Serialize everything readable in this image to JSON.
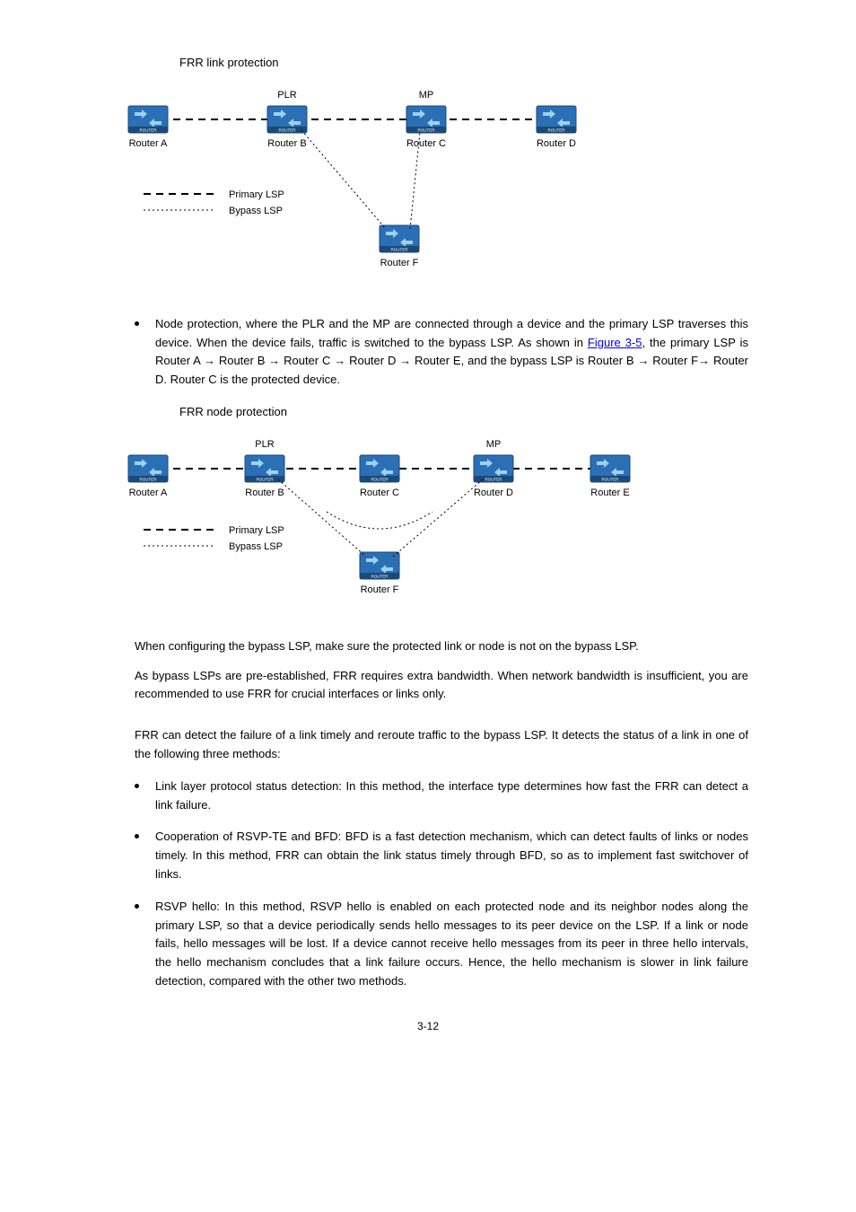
{
  "figure1": {
    "caption": "FRR link protection",
    "roles": {
      "plr": "PLR",
      "mp": "MP"
    },
    "routers": {
      "a": "Router A",
      "b": "Router B",
      "c": "Router C",
      "d": "Router D",
      "f": "Router F"
    },
    "legend": {
      "primary": "Primary LSP",
      "bypass": "Bypass LSP"
    }
  },
  "bullet_node_protection": {
    "pre": "Node protection, where the PLR and the MP are connected through a device and the primary LSP traverses this device. When the device fails, traffic is switched to the bypass LSP. As shown in ",
    "link": "Figure 3-5",
    "post": ", the primary LSP is Router A → Router B → Router C → Router D → Router E, and the bypass LSP is Router B → Router F→ Router D. Router C is the protected device."
  },
  "figure2": {
    "caption": "FRR node protection",
    "roles": {
      "plr": "PLR",
      "mp": "MP"
    },
    "routers": {
      "a": "Router A",
      "b": "Router B",
      "c": "Router C",
      "d": "Router D",
      "e": "Router E",
      "f": "Router F"
    },
    "legend": {
      "primary": "Primary LSP",
      "bypass": "Bypass LSP"
    }
  },
  "para1": "When configuring the bypass LSP, make sure the protected link or node is not on the bypass LSP.",
  "para2": "As bypass LSPs are pre-established, FRR requires extra bandwidth. When network bandwidth is insufficient, you are recommended to use FRR for crucial interfaces or links only.",
  "para3": "FRR can detect the failure of a link timely and reroute traffic to the bypass LSP. It detects the status of a link in one of the following three methods:",
  "bullets": {
    "b1": "Link layer protocol status detection: In this method, the interface type determines how fast the FRR can detect a link failure.",
    "b2": "Cooperation of RSVP-TE and BFD: BFD is a fast detection mechanism, which can detect faults of links or nodes timely. In this method, FRR can obtain the link status timely through BFD, so as to implement fast switchover of links.",
    "b3": "RSVP hello: In this method, RSVP hello is enabled on each protected node and its neighbor nodes along the primary LSP, so that a device periodically sends hello messages to its peer device on the LSP. If a link or node fails, hello messages will be lost. If a device cannot receive hello messages from its peer in three hello intervals, the hello mechanism concludes that a link failure occurs. Hence, the hello mechanism is slower in link failure detection, compared with the other two methods."
  },
  "pagenum": "3-12"
}
